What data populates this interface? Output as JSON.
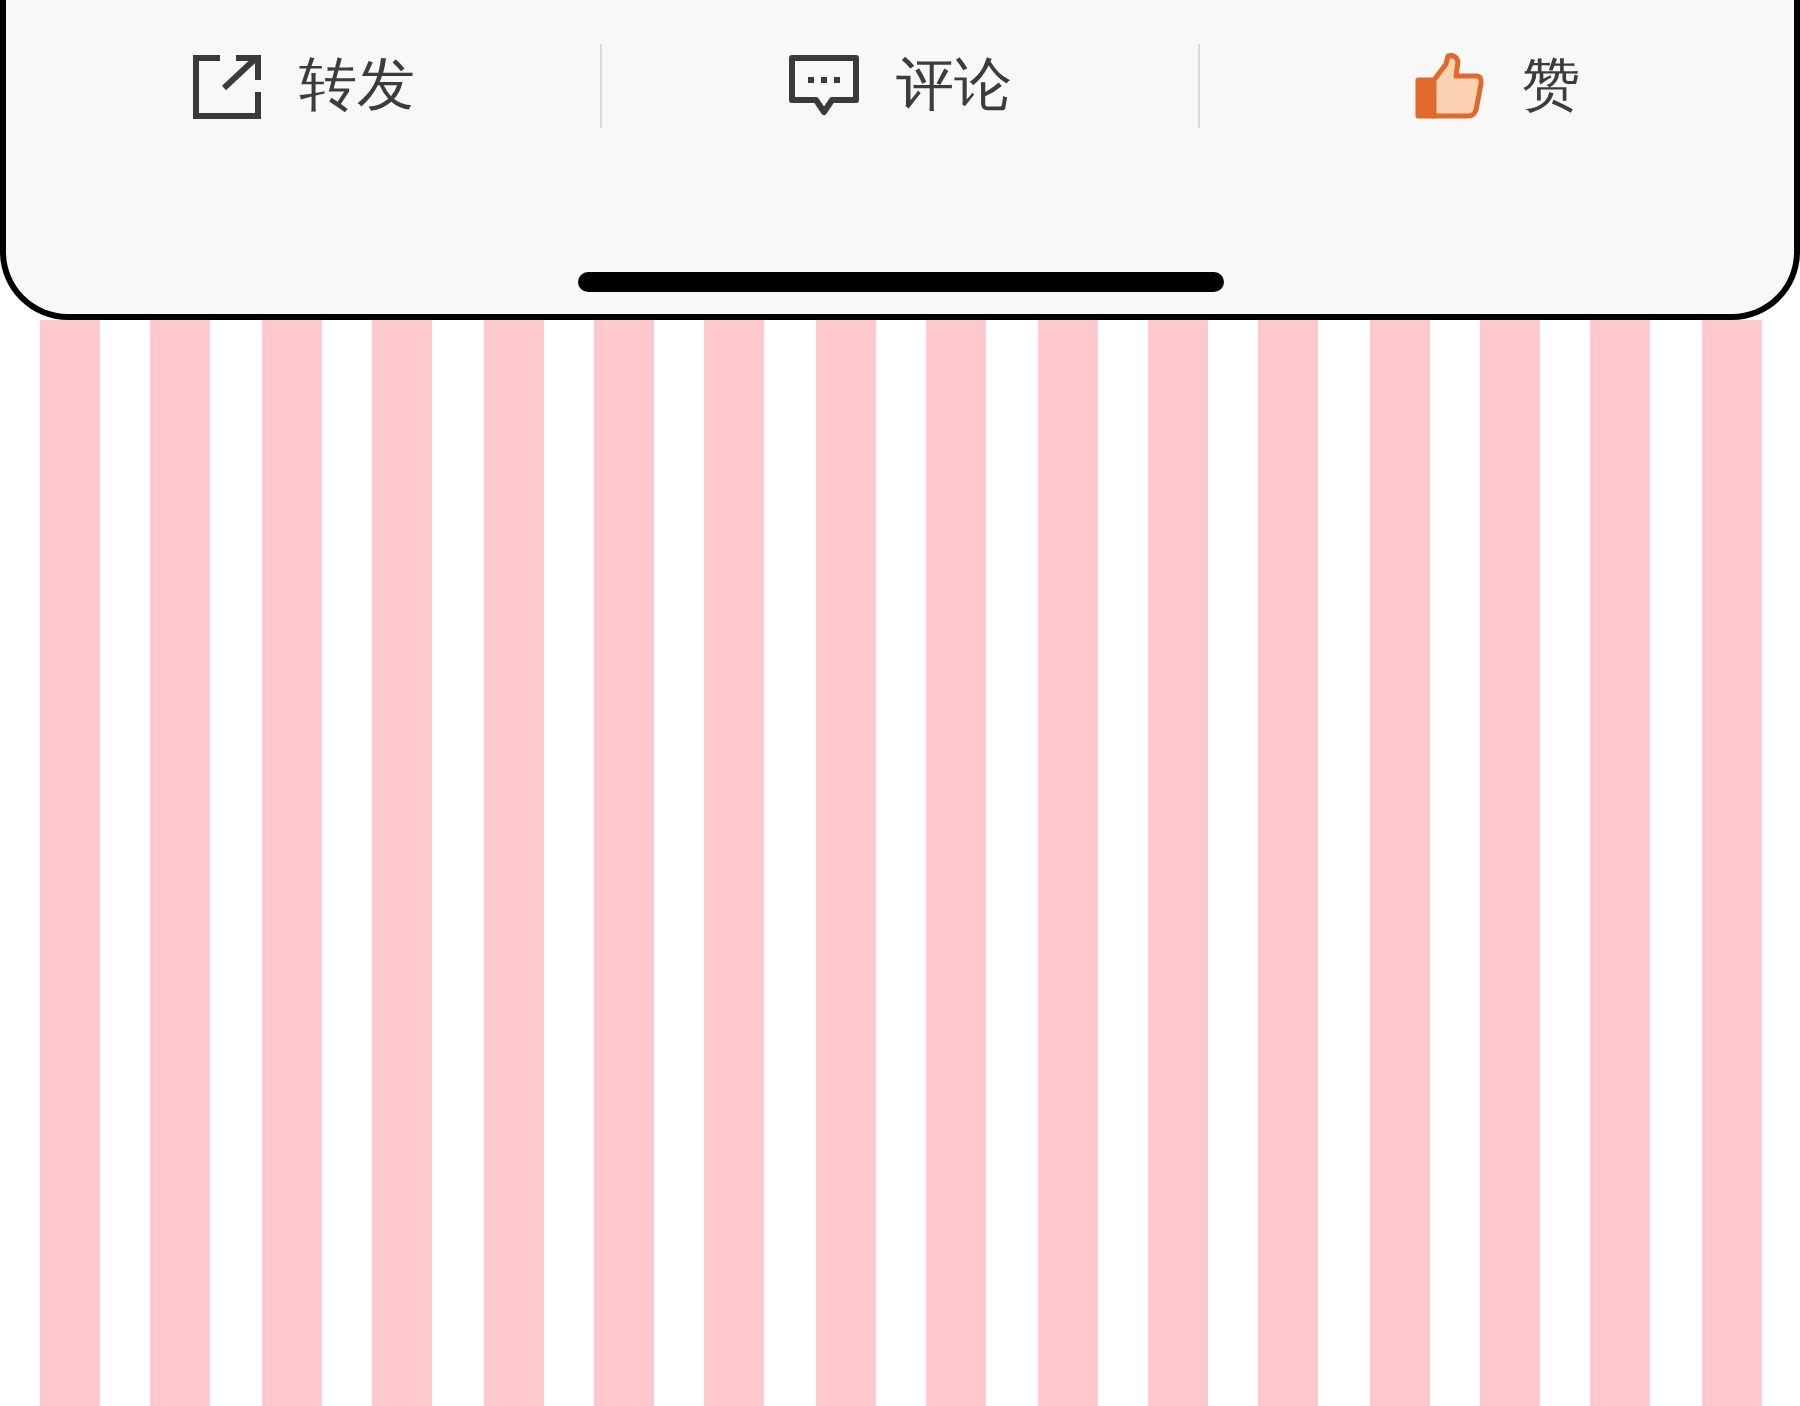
{
  "action_bar": {
    "actions": [
      {
        "kind": "share",
        "label": "转发",
        "active": false
      },
      {
        "kind": "comment",
        "label": "评论",
        "active": false
      },
      {
        "kind": "like",
        "label": "赞",
        "active": true
      }
    ]
  }
}
